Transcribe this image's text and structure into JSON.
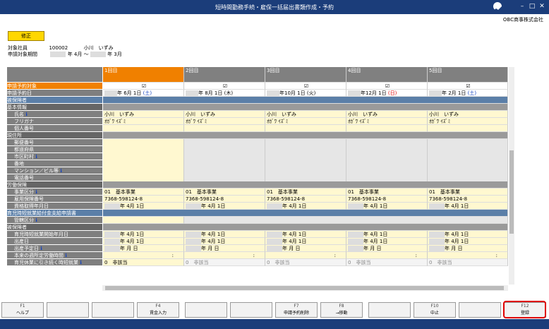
{
  "window": {
    "title": "短時間勤務手続・雇保一括届出書類作成・予約",
    "company": "OBC商事株式会社"
  },
  "modify_label": "修正",
  "target_employee_label": "対象社員",
  "employee_code": "100002",
  "employee_name": "小川　いずみ",
  "period_label": "申請対象期間",
  "period_from": "年 4月 ～",
  "period_to": "年 3月",
  "columns": [
    "1回目",
    "2回目",
    "3回目",
    "4回目",
    "5回目"
  ],
  "row_labels": {
    "target": "申請予約対象",
    "date": "申請予約日",
    "insured": "被保険者",
    "basic": "基本情報",
    "name": "氏名",
    "kana": "フリガナ",
    "mynumber": "個人番号",
    "address": "現住所",
    "zip": "郵便番号",
    "pref": "都道府県",
    "city": "市区町村",
    "banchi": "番地",
    "building": "マンション／ビル等",
    "tel": "電話番号",
    "labor": "労働保険",
    "office": "事業区分",
    "insno": "雇用保険番号",
    "acquired": "資格取得年月日",
    "benefit": "育児時短就業給付金支給申請書",
    "jurisdiction": "管轄区分",
    "insured2": "被保険者",
    "start": "育児時短就業開始年月日",
    "birth": "出産日",
    "due": "出産予定日",
    "hours": "本来の週所定労働時間",
    "continue": "育児休業に引き続く時短就業"
  },
  "dates": [
    {
      "pre": "年",
      "m": " 6月",
      "d": " 1日",
      "dow": "(土)",
      "c": "blue"
    },
    {
      "pre": "年",
      "m": " 8月",
      "d": " 1日",
      "dow": "(木)",
      "c": "black"
    },
    {
      "pre": "年",
      "m": "10月",
      "d": " 1日",
      "dow": "(火)",
      "c": "black"
    },
    {
      "pre": "年",
      "m": "12月",
      "d": " 1日",
      "dow": "(日)",
      "c": "red"
    },
    {
      "pre": "年",
      "m": " 2月",
      "d": " 1日",
      "dow": "(土)",
      "c": "blue"
    }
  ],
  "kana_value": "ｵｶﾞﾜ ｲｽﾞﾐ",
  "office_code": "01",
  "office_name": "基本事業",
  "ins_number": "7368-598124-8",
  "acq_date": "年 4月 1日",
  "start_date": "年 4月 1日",
  "birth_date": "年 4月 1日",
  "due_date": "年 月 日",
  "hours_value": ":",
  "continue_values": [
    {
      "n": "0",
      "t": "非該当"
    },
    {
      "n": "0",
      "t": "非該当"
    },
    {
      "n": "0",
      "t": "非該当"
    },
    {
      "n": "0",
      "t": "非該当"
    },
    {
      "n": "0",
      "t": "非該当"
    }
  ],
  "fkeys": [
    {
      "key": "F1",
      "label": "ヘルプ"
    },
    {
      "key": "",
      "label": ""
    },
    {
      "key": "",
      "label": ""
    },
    {
      "key": "F4",
      "label": "賃金入力"
    },
    {
      "key": "",
      "label": ""
    },
    {
      "key": "",
      "label": ""
    },
    {
      "key": "F7",
      "label": "申請予約削除"
    },
    {
      "key": "F8",
      "label": "→移動"
    },
    {
      "key": "",
      "label": ""
    },
    {
      "key": "F10",
      "label": "中止"
    },
    {
      "key": "",
      "label": ""
    },
    {
      "key": "F12",
      "label": "登録"
    }
  ],
  "colors": {
    "titlebar": "#1b3d7a",
    "accent": "#f08000",
    "section": "#5b7fa8",
    "highlight": "#e00000"
  }
}
